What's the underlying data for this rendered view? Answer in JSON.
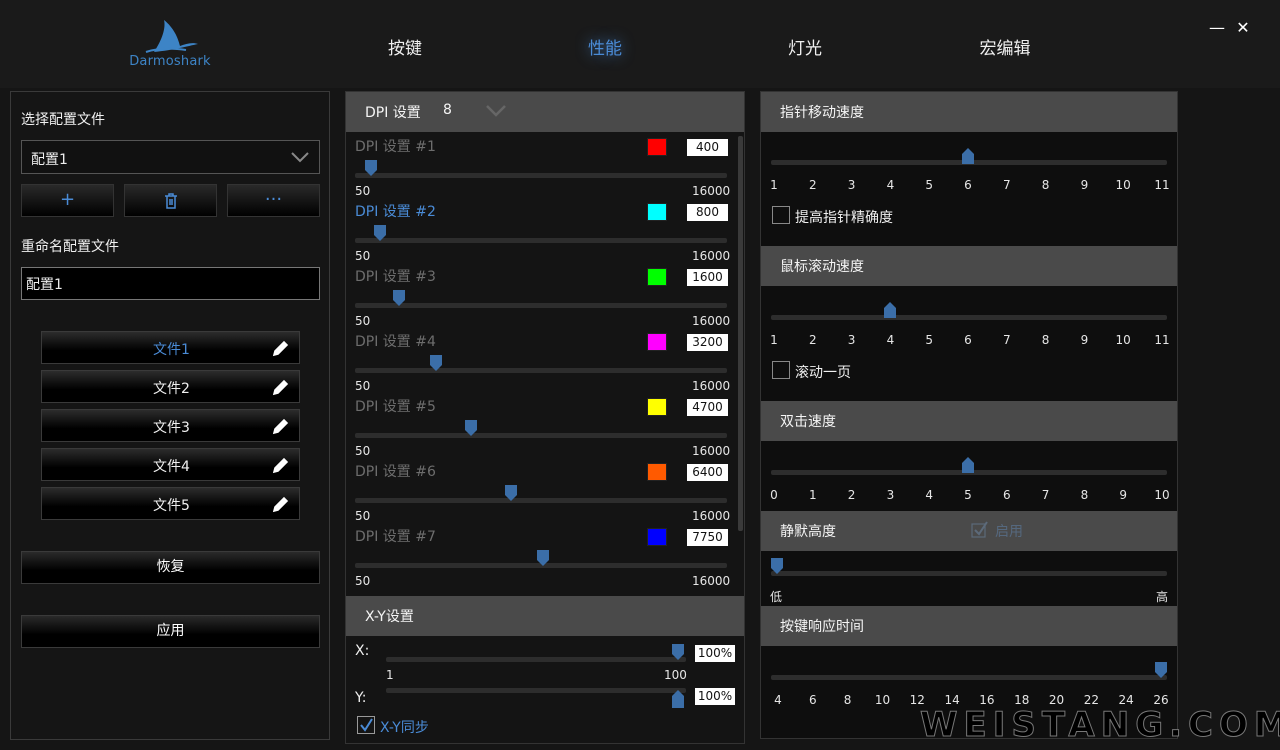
{
  "app": {
    "logo_text": "Darmoshark",
    "tabs": [
      "按键",
      "性能",
      "灯光",
      "宏编辑"
    ],
    "active_tab": 1,
    "minimize": "—",
    "close": "✕"
  },
  "left": {
    "select_label": "选择配置文件",
    "selected_profile": "配置1",
    "add_icon": "+",
    "delete_icon": "trash-icon",
    "more_icon": "···",
    "rename_label": "重命名配置文件",
    "rename_value": "配置1",
    "files": [
      "文件1",
      "文件2",
      "文件3",
      "文件4",
      "文件5"
    ],
    "active_file": 0,
    "restore": "恢复",
    "apply": "应用"
  },
  "dpi": {
    "title": "DPI 设置",
    "count": "8",
    "min": "50",
    "max": "16000",
    "active_index": 1,
    "rows": [
      {
        "title": "DPI 设置 #1",
        "color": "#ff0000",
        "value": "400"
      },
      {
        "title": "DPI 设置 #2",
        "color": "#00ffff",
        "value": "800"
      },
      {
        "title": "DPI 设置 #3",
        "color": "#00ff00",
        "value": "1600"
      },
      {
        "title": "DPI 设置 #4",
        "color": "#ff00ff",
        "value": "3200"
      },
      {
        "title": "DPI 设置 #5",
        "color": "#ffff00",
        "value": "4700"
      },
      {
        "title": "DPI 设置 #6",
        "color": "#ff5a00",
        "value": "6400"
      },
      {
        "title": "DPI 设置 #7",
        "color": "#0000ff",
        "value": "7750"
      }
    ]
  },
  "xy": {
    "title": "X-Y设置",
    "x_label": "X:",
    "y_label": "Y:",
    "x_value": "100%",
    "y_value": "100%",
    "min": "1",
    "max": "100",
    "sync_label": "X-Y同步",
    "sync_checked": true
  },
  "pointer": {
    "title": "指针移动速度",
    "ticks": [
      "1",
      "2",
      "3",
      "4",
      "5",
      "6",
      "7",
      "8",
      "9",
      "10",
      "11"
    ],
    "value": 6,
    "precision_label": "提高指针精确度"
  },
  "scroll": {
    "title": "鼠标滚动速度",
    "ticks": [
      "1",
      "2",
      "3",
      "4",
      "5",
      "6",
      "7",
      "8",
      "9",
      "10",
      "11"
    ],
    "value": 4,
    "page_label": "滚动一页"
  },
  "dblclick": {
    "title": "双击速度",
    "ticks": [
      "0",
      "1",
      "2",
      "3",
      "4",
      "5",
      "6",
      "7",
      "8",
      "9",
      "10"
    ],
    "value": 5
  },
  "silent": {
    "title": "静默高度",
    "enable_label": "启用",
    "low": "低",
    "high": "高",
    "level_fraction": 0
  },
  "response": {
    "title": "按键响应时间",
    "ticks": [
      "4",
      "6",
      "8",
      "10",
      "12",
      "14",
      "16",
      "18",
      "20",
      "22",
      "24",
      "26"
    ],
    "value": "26"
  },
  "colors": {
    "accent": "#4a8bd6",
    "header": "#4a4a4a"
  },
  "watermark": "WEISTANG.COM"
}
